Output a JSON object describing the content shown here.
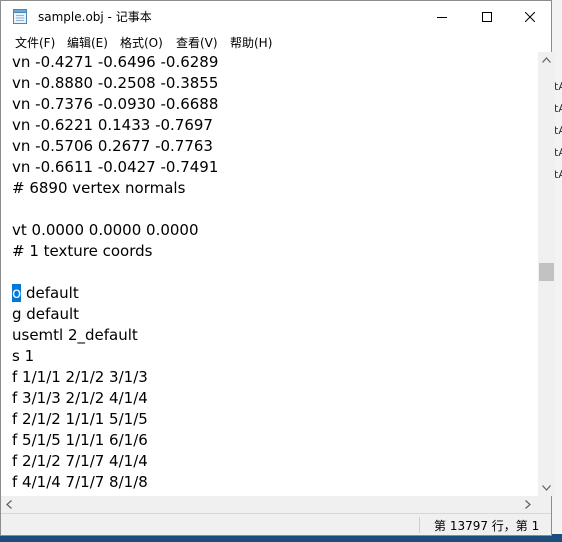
{
  "window": {
    "title": "sample.obj - 记事本",
    "icon": "notepad-icon"
  },
  "controls": {
    "minimize_icon": "minimize-icon",
    "maximize_icon": "maximize-icon",
    "close_icon": "close-icon"
  },
  "menu": {
    "items": [
      {
        "label": "文件(F)"
      },
      {
        "label": "编辑(E)"
      },
      {
        "label": "格式(O)"
      },
      {
        "label": "查看(V)"
      },
      {
        "label": "帮助(H)"
      }
    ]
  },
  "editor": {
    "lines": [
      "vn -0.4271 -0.6496 -0.6289",
      "vn -0.8880 -0.2508 -0.3855",
      "vn -0.7376 -0.0930 -0.6688",
      "vn -0.6221 0.1433 -0.7697",
      "vn -0.5706 0.2677 -0.7763",
      "vn -0.6611 -0.0427 -0.7491",
      "# 6890 vertex normals",
      "",
      "vt 0.0000 0.0000 0.0000",
      "# 1 texture coords",
      "",
      "o default",
      "g default",
      "usemtl 2_default",
      "s 1",
      "f 1/1/1 2/1/2 3/1/3",
      "f 3/1/3 2/1/2 4/1/4",
      "f 2/1/2 1/1/1 5/1/5",
      "f 5/1/5 1/1/1 6/1/6",
      "f 2/1/2 7/1/7 4/1/4",
      "f 4/1/4 7/1/7 8/1/8"
    ],
    "selected_text": "o",
    "selected_rest": " default",
    "accent_color": "#0078d7"
  },
  "status": {
    "position": "第 13797 行，第 1"
  },
  "background": {
    "peek_lines": [
      "tA",
      "tA",
      "tA",
      "tA",
      "tA"
    ]
  }
}
